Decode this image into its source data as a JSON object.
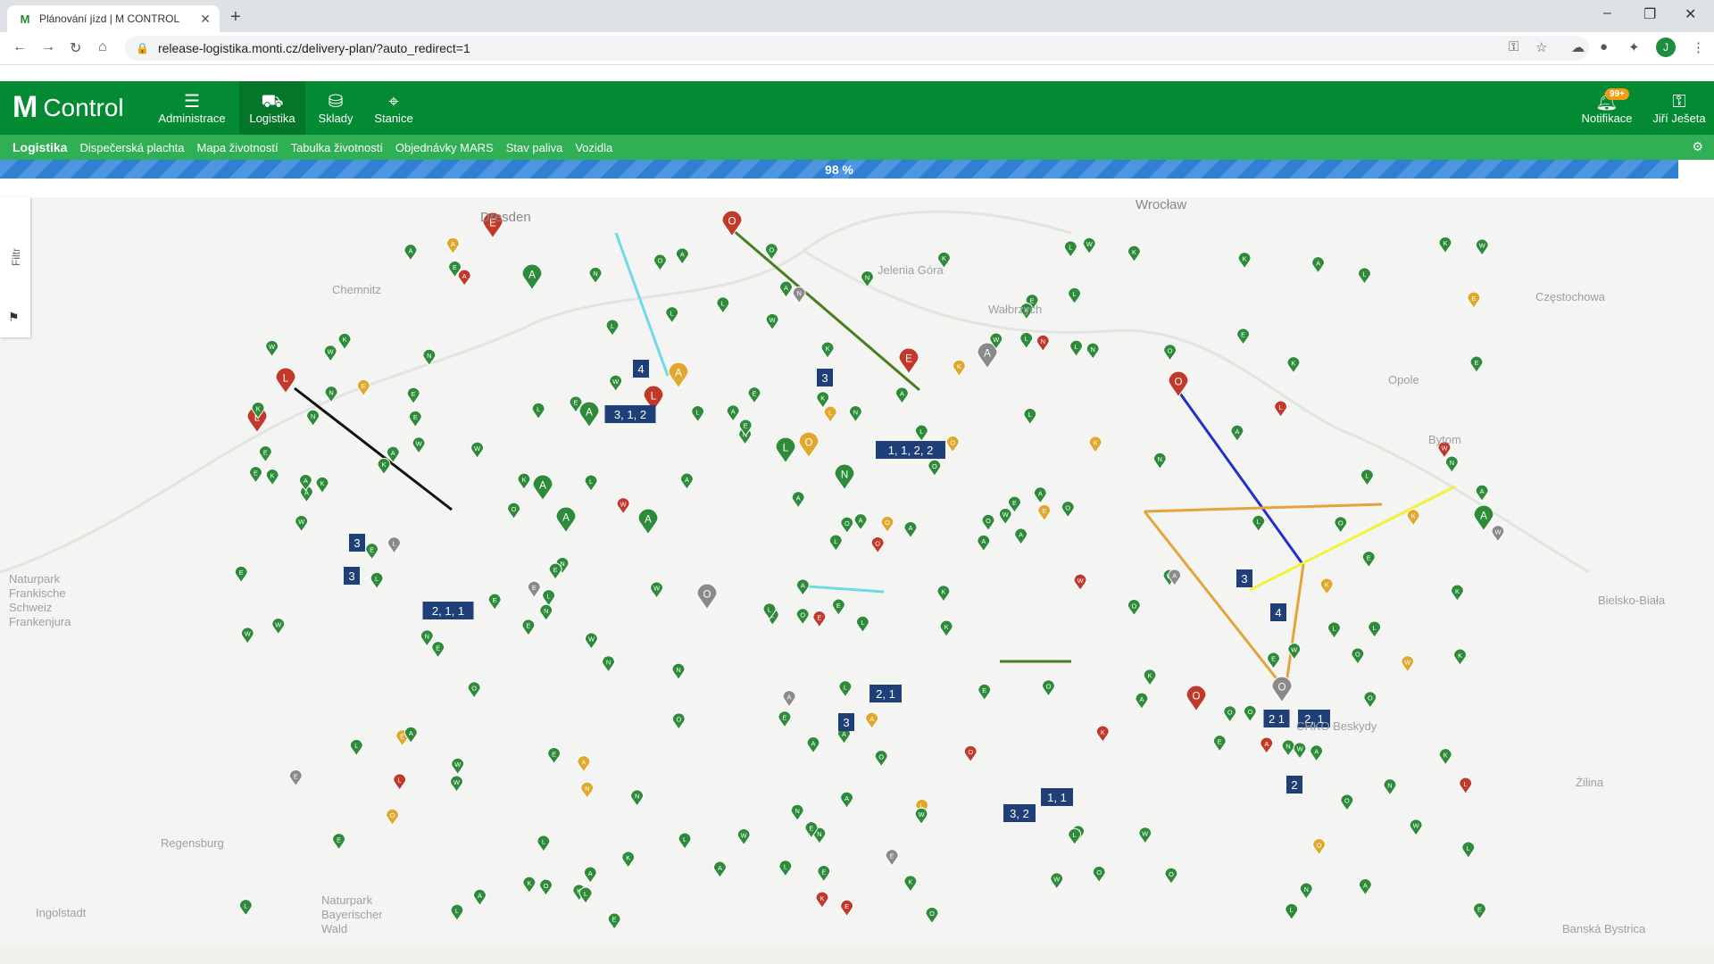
{
  "browser": {
    "tab_title": "Plánování jízd | M CONTROL",
    "url": "release-logistika.monti.cz/delivery-plan/?auto_redirect=1",
    "profile_initial": "J"
  },
  "app": {
    "logo_text": "Control",
    "menu": [
      {
        "label": "Administrace",
        "icon": "sliders-icon"
      },
      {
        "label": "Logistika",
        "icon": "truck-icon"
      },
      {
        "label": "Sklady",
        "icon": "database-icon"
      },
      {
        "label": "Stanice",
        "icon": "map-pin-icon"
      }
    ],
    "notifications": {
      "label": "Notifikace",
      "badge": "99+"
    },
    "user": {
      "name": "Jiří Ješeta"
    }
  },
  "subnav": {
    "section": "Logistika",
    "items": [
      "Dispečerská plachta",
      "Mapa životností",
      "Tabulka životností",
      "Objednávky MARS",
      "Stav paliva",
      "Vozidla"
    ]
  },
  "progress": {
    "value": 0.98,
    "label": "98 %"
  },
  "filter": {
    "label": "Filtr"
  },
  "map": {
    "place_labels": [
      "Dresden",
      "Wrocław",
      "Chemnitz",
      "Jelenia Góra",
      "Wałbrzych",
      "Naturpark Frankische Schweiz Frankenjura",
      "Regensburg",
      "Ingolstadt",
      "Naturpark Bayerischer Wald",
      "Opole",
      "Bytom",
      "Częstochowa",
      "Bielsko-Biała",
      "Żilina",
      "Banská Bystrica",
      "CHKO Beskydy"
    ],
    "route_labels": [
      "4",
      "3, 1, 2",
      "3",
      "1, 1, 2, 2",
      "3",
      "3",
      "2, 1, 1",
      "3",
      "4",
      "2 1",
      "2, 1",
      "2",
      "2, 1",
      "3",
      "3, 2",
      "1, 1"
    ],
    "colors": {
      "green_marker": "#2e8b3a",
      "red_marker": "#c0392b",
      "yellow_marker": "#e0a82e",
      "grey_marker": "#8a8a8a",
      "route_cyan": "#6fd9e6",
      "route_green": "#4a7d1d",
      "route_black": "#111111",
      "route_blue": "#1f2fc9",
      "route_orange": "#e3a43a",
      "route_yellow": "#f2f23a"
    }
  }
}
